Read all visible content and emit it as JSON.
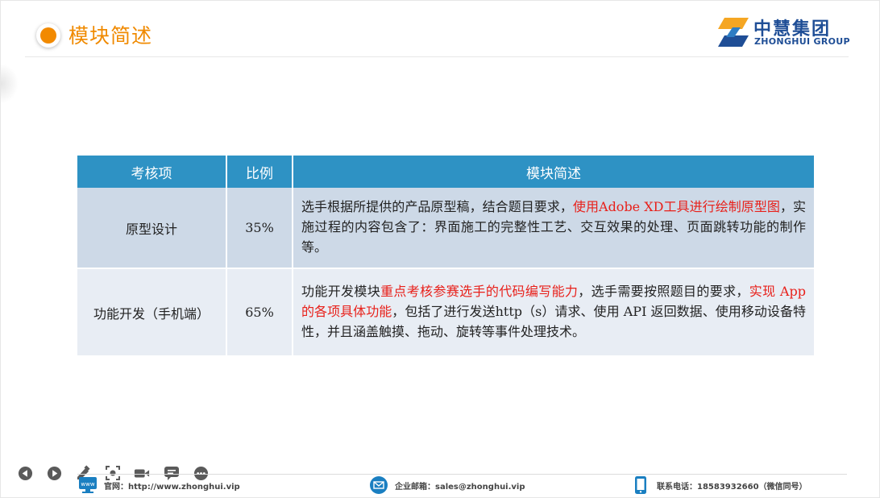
{
  "header": {
    "title": "模块简述",
    "accent_color": "#f08a00"
  },
  "logo": {
    "name_cn": "中慧集团",
    "name_en": "ZHONGHUI GROUP",
    "brand_color": "#1f4e96",
    "accent_color": "#f5a623"
  },
  "table": {
    "header_color": "#2e92c4",
    "columns": [
      "考核项",
      "比例",
      "模块简述"
    ],
    "rows": [
      {
        "name": "原型设计",
        "ratio": "35%",
        "desc_1": "选手根据所提供的产品原型稿，结合题目要求，",
        "desc_red_1": "使用Adobe XD工具进行绘制原型图",
        "desc_2": "，实施过程的内容包含了：界面施工的完整性工艺、交互效果的处理、页面跳转功能的制作等。"
      },
      {
        "name": "功能开发（手机端）",
        "ratio": "65%",
        "desc_1": "功能开发模块",
        "desc_red_1": "重点考核参赛选手的代码编写能力",
        "desc_2": "，选手需要按照题目的要求，",
        "desc_red_2": "实现 App 的各项具体功能",
        "desc_3": "，包括了进行发送http（s）请求、使用 API 返回数据、使用移动设备特性，并且涵盖触摸、拖动、旋转等事件处理技术。"
      }
    ]
  },
  "toolbar": {
    "buttons": [
      "prev-icon",
      "next-icon",
      "pen-icon",
      "zoom-icon",
      "video-icon",
      "comment-icon",
      "more-icon"
    ]
  },
  "footer": {
    "website": "官网：http://www.zhonghui.vip",
    "email": "企业邮箱：sales@zhonghui.vip",
    "phone": "联系电话：18583932660（微信同号）",
    "www_icon_text": "www",
    "icon_color": "#1a7fc1"
  }
}
